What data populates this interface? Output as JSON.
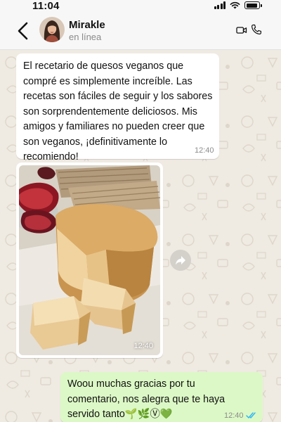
{
  "status_bar": {
    "time": "11:04"
  },
  "contact": {
    "name": "Mirakle",
    "status": "en línea"
  },
  "icons": {
    "back": "chevron-left-icon",
    "video": "video-camera-icon",
    "call": "phone-icon",
    "forward": "forward-arrow-icon",
    "read_receipt": "double-check-icon"
  },
  "colors": {
    "header_bg": "#f7f7f7",
    "chat_bg": "#efeae2",
    "incoming_bubble": "#ffffff",
    "outgoing_bubble": "#dcf8c6",
    "read_tick": "#34b7f1"
  },
  "messages": [
    {
      "direction": "incoming",
      "type": "text",
      "text": "El recetario de quesos veganos que compré es simplemente increíble. Las recetas son fáciles de seguir y los sabores son sorprendentemente deliciosos. Mis amigos y familiares no pueden creer que son veganos, ¡definitivamente lo recomiendo!",
      "time": "12:40"
    },
    {
      "direction": "incoming",
      "type": "image",
      "time": "12:40"
    },
    {
      "direction": "outgoing",
      "type": "text",
      "text": "Woou muchas gracias por tu comentario, nos alegra que te haya servido tanto🌱🌿Ⓥ💚",
      "time": "12:40",
      "read": true
    }
  ]
}
